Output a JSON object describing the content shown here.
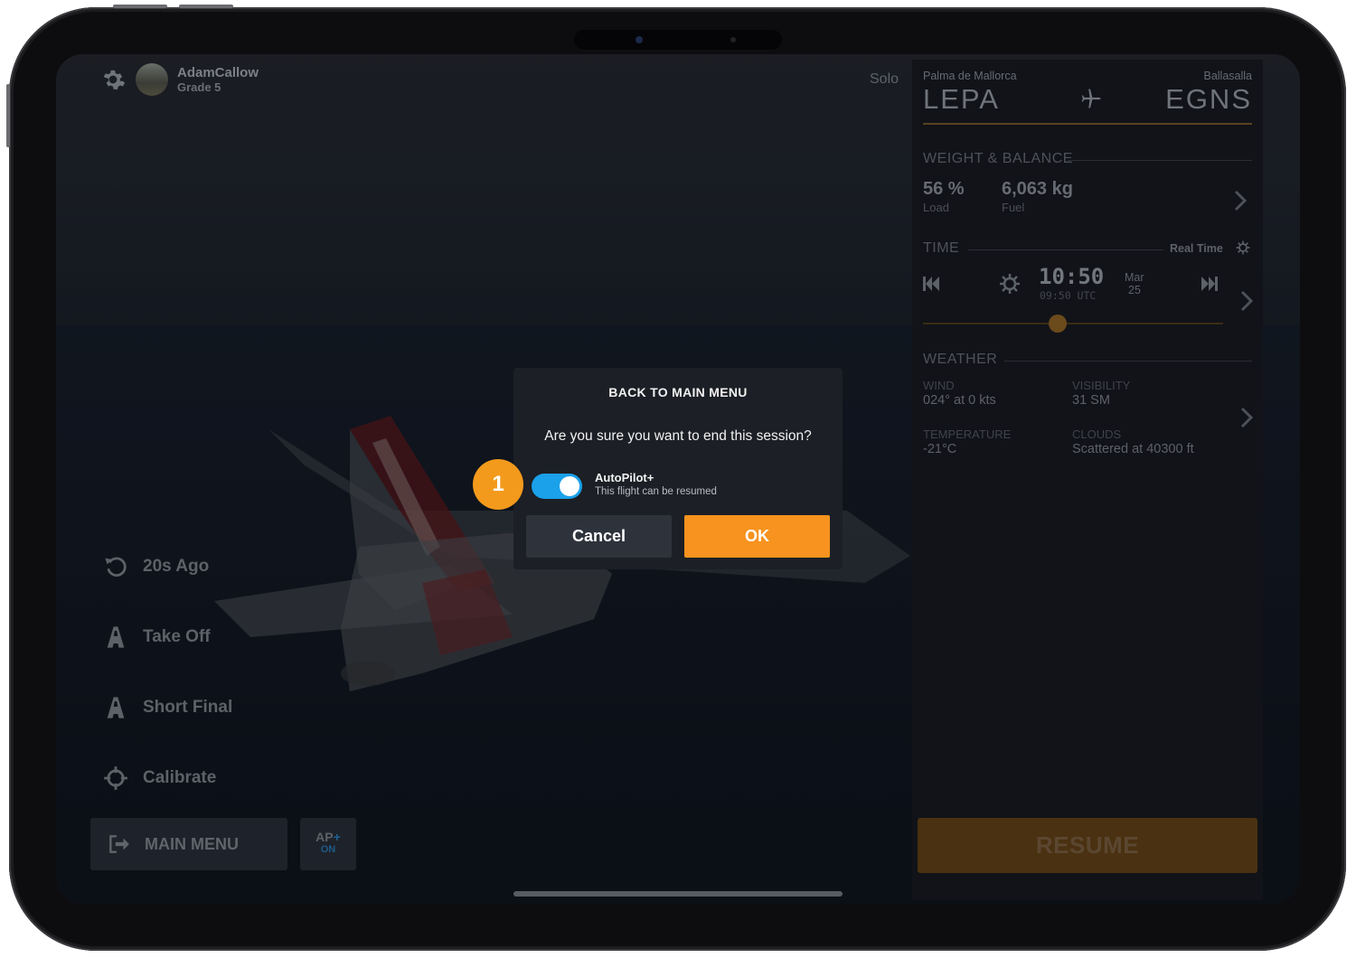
{
  "user": {
    "name": "AdamCallow",
    "grade": "Grade 5"
  },
  "mode": "Solo",
  "left_menu": {
    "items": [
      {
        "label": "20s Ago",
        "icon": "rewind-icon"
      },
      {
        "label": "Take Off",
        "icon": "runway-icon"
      },
      {
        "label": "Short Final",
        "icon": "runway-icon"
      },
      {
        "label": "Calibrate",
        "icon": "crosshair-icon"
      }
    ],
    "main_menu_label": "MAIN MENU",
    "ap": {
      "label": "AP",
      "plus": "+",
      "state": "ON"
    }
  },
  "route": {
    "origin_name": "Palma de Mallorca",
    "origin_code": "LEPA",
    "dest_name": "Ballasalla",
    "dest_code": "EGNS"
  },
  "weight_balance": {
    "title": "WEIGHT & BALANCE",
    "load_value": "56 %",
    "load_label": "Load",
    "fuel_value": "6,063 kg",
    "fuel_label": "Fuel"
  },
  "time": {
    "title": "TIME",
    "real_time_label": "Real Time",
    "local": "10:50",
    "utc": "09:50 UTC",
    "month": "Mar",
    "day": "25",
    "slider_fraction": 0.45
  },
  "weather": {
    "title": "WEATHER",
    "wind_label": "WIND",
    "wind_value": "024° at 0 kts",
    "visibility_label": "VISIBILITY",
    "visibility_value": "31 SM",
    "temperature_label": "TEMPERATURE",
    "temperature_value": "-21°C",
    "clouds_label": "CLOUDS",
    "clouds_value": "Scattered at 40300 ft"
  },
  "resume_label": "RESUME",
  "dialog": {
    "title": "BACK TO MAIN MENU",
    "message": "Are you sure you want to end this session?",
    "autopilot_label": "AutoPilot+",
    "autopilot_sub": "This flight can be resumed",
    "autopilot_enabled": true,
    "cancel_label": "Cancel",
    "ok_label": "OK"
  },
  "callout_number": "1",
  "colors": {
    "accent": "#f7931e",
    "toggle_on": "#1aa1ea",
    "dialog_bg": "#1c1f25"
  }
}
